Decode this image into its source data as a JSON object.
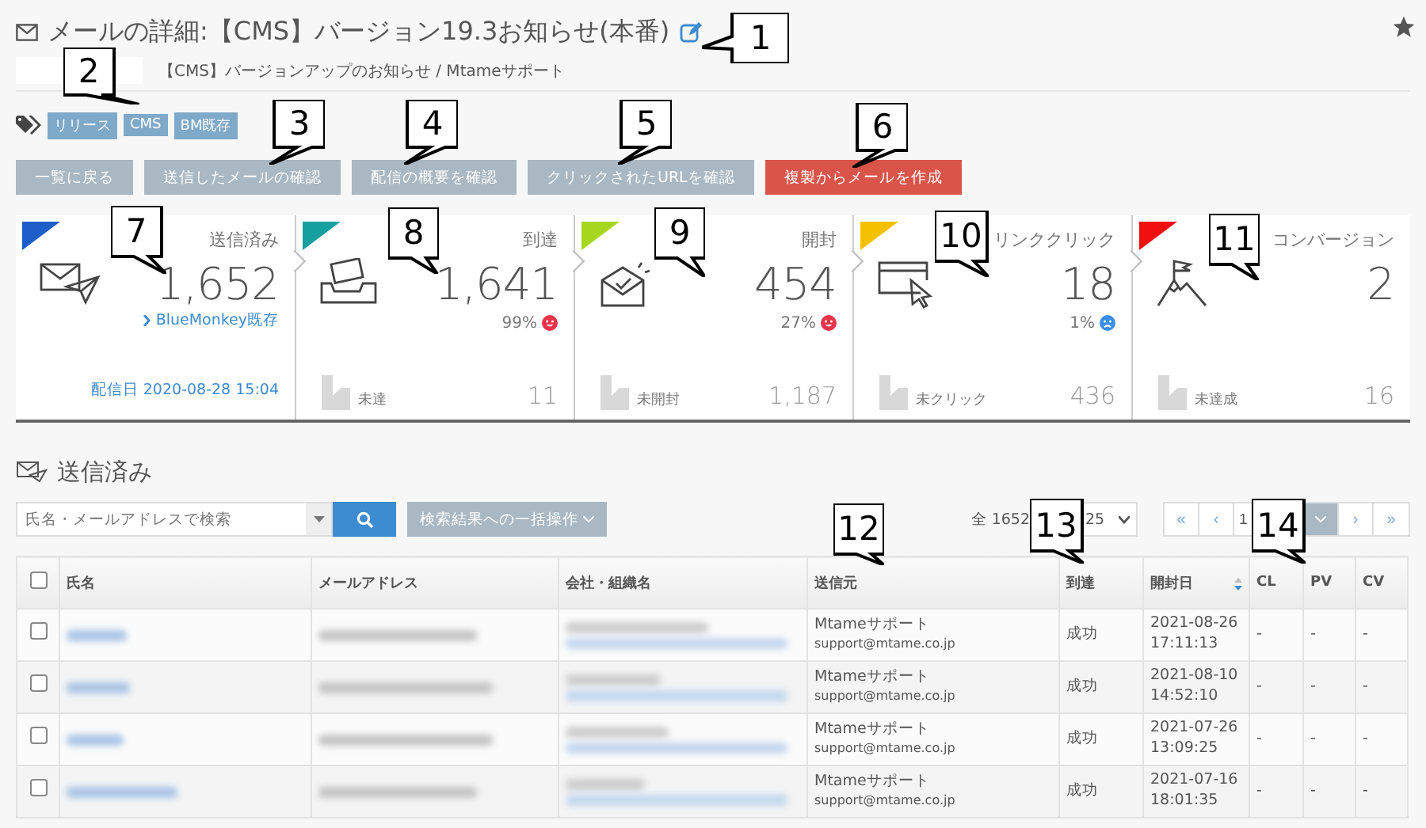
{
  "header": {
    "title": "メールの詳細:【CMS】バージョン19.3お知らせ(本番)",
    "subject": "【CMS】バージョンアップのお知らせ / Mtameサポート"
  },
  "tags": [
    "リリース",
    "CMS",
    "BM既存"
  ],
  "actions": [
    {
      "label": "一覧に戻る",
      "kind": "default"
    },
    {
      "label": "送信したメールの確認",
      "kind": "default"
    },
    {
      "label": "配信の概要を確認",
      "kind": "default"
    },
    {
      "label": "クリックされたURLを確認",
      "kind": "default"
    },
    {
      "label": "複製からメールを作成",
      "kind": "danger"
    }
  ],
  "stats": [
    {
      "kind": "send",
      "label": "送信済み",
      "color": "#1d5ec9",
      "value": "1,652",
      "link": "BlueMonkey既存",
      "date_label": "配信日",
      "date": "2020-08-28 15:04"
    },
    {
      "kind": "inbox",
      "label": "到達",
      "color": "#16a0a0",
      "value": "1,641",
      "rate": "99%",
      "happy": true,
      "sub_label": "未達",
      "sub_value": "11"
    },
    {
      "kind": "open",
      "label": "開封",
      "color": "#a6d61e",
      "value": "454",
      "rate": "27%",
      "happy": true,
      "sub_label": "未開封",
      "sub_value": "1,187"
    },
    {
      "kind": "click",
      "label": "リンククリック",
      "color": "#f5c000",
      "value": "18",
      "rate": "1%",
      "happy": false,
      "sub_label": "未クリック",
      "sub_value": "436"
    },
    {
      "kind": "goal",
      "label": "コンバージョン",
      "color": "#f01010",
      "value": "2",
      "sub_label": "未達成",
      "sub_value": "16"
    }
  ],
  "list": {
    "title": "送信済み",
    "search": {
      "placeholder": "氏名・メールアドレスで検索"
    },
    "bulk_button": "検索結果への一括操作",
    "total": "全 1652",
    "per_page": "25",
    "pager": {
      "first": "«",
      "prev": "‹",
      "page": "1",
      "next": "›",
      "last": "»"
    }
  },
  "table": {
    "select_all_checked": false,
    "columns": [
      "氏名",
      "メールアドレス",
      "会社・組織名",
      "送信元",
      "到達",
      "開封日",
      "CL",
      "PV",
      "CV"
    ],
    "rows": [
      {
        "checked": false,
        "sender": "Mtameサポート",
        "sender_email": "support@mtame.co.jp",
        "status": "成功",
        "opened_date": "2021-08-26",
        "opened_time": "17:11:13",
        "cl": "-",
        "pv": "-",
        "cv": "-"
      },
      {
        "checked": false,
        "sender": "Mtameサポート",
        "sender_email": "support@mtame.co.jp",
        "status": "成功",
        "opened_date": "2021-08-10",
        "opened_time": "14:52:10",
        "cl": "-",
        "pv": "-",
        "cv": "-"
      },
      {
        "checked": false,
        "sender": "Mtameサポート",
        "sender_email": "support@mtame.co.jp",
        "status": "成功",
        "opened_date": "2021-07-26",
        "opened_time": "13:09:25",
        "cl": "-",
        "pv": "-",
        "cv": "-"
      },
      {
        "checked": false,
        "sender": "Mtameサポート",
        "sender_email": "support@mtame.co.jp",
        "status": "成功",
        "opened_date": "2021-07-16",
        "opened_time": "18:01:35",
        "cl": "-",
        "pv": "-",
        "cv": "-"
      }
    ]
  },
  "callouts": [
    "1",
    "2",
    "3",
    "4",
    "5",
    "6",
    "7",
    "8",
    "9",
    "10",
    "11",
    "12",
    "13",
    "14"
  ]
}
